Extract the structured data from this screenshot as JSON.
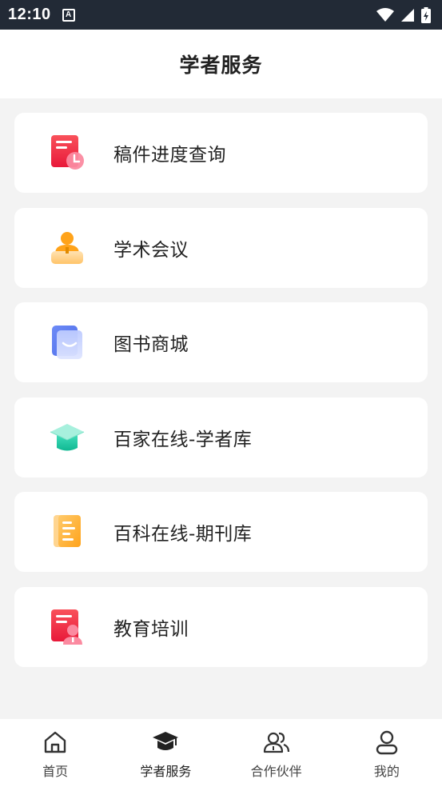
{
  "status_bar": {
    "time": "12:10",
    "app_icon_letter": "A"
  },
  "header": {
    "title": "学者服务"
  },
  "menu": [
    {
      "label": "稿件进度查询",
      "icon": "manuscript-progress-icon"
    },
    {
      "label": "学术会议",
      "icon": "conference-icon"
    },
    {
      "label": "图书商城",
      "icon": "bookstore-icon"
    },
    {
      "label": "百家在线-学者库",
      "icon": "scholar-cap-icon"
    },
    {
      "label": "百科在线-期刊库",
      "icon": "journal-icon"
    },
    {
      "label": "教育培训",
      "icon": "training-icon"
    }
  ],
  "tabs": [
    {
      "label": "首页",
      "icon": "home-icon",
      "active": false
    },
    {
      "label": "学者服务",
      "icon": "graduation-cap-icon",
      "active": true
    },
    {
      "label": "合作伙伴",
      "icon": "partners-icon",
      "active": false
    },
    {
      "label": "我的",
      "icon": "profile-icon",
      "active": false
    }
  ],
  "colors": {
    "status_bar_bg": "#222a36",
    "page_bg": "#f3f3f3",
    "red_icon": "#f5333f",
    "orange_icon": "#ffa31a",
    "blue_icon": "#6f86f5",
    "teal_icon": "#1ec8a5"
  }
}
